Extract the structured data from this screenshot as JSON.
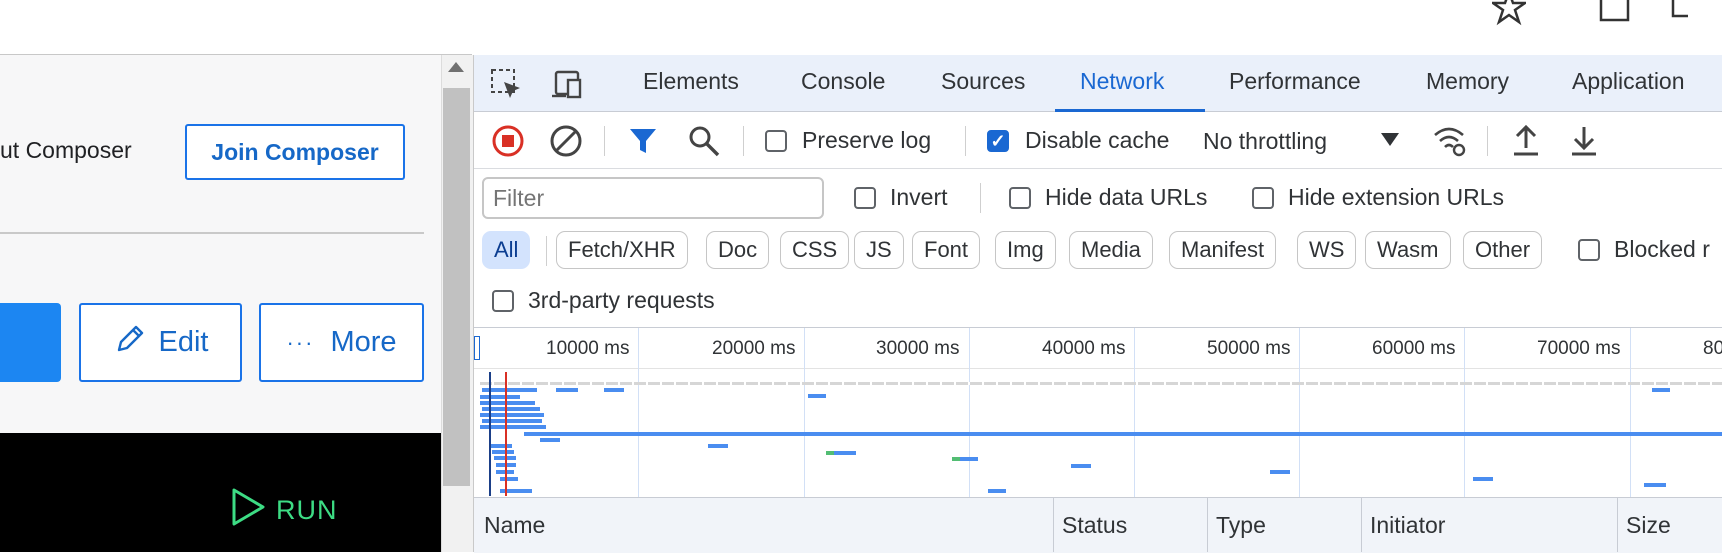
{
  "browser": {
    "icons": [
      "star-icon",
      "extensions-icon"
    ]
  },
  "page": {
    "about_text": "ut Composer",
    "join_label": "Join Composer",
    "edit_label": "Edit",
    "more_label": "More",
    "more_dots": "···",
    "run_label": "RUN"
  },
  "devtools": {
    "tabs": [
      "Elements",
      "Console",
      "Sources",
      "Network",
      "Performance",
      "Memory",
      "Application"
    ],
    "active_tab": "Network",
    "toolbar": {
      "preserve_log": "Preserve log",
      "preserve_log_checked": false,
      "disable_cache": "Disable cache",
      "disable_cache_checked": true,
      "throttling": "No throttling"
    },
    "filter": {
      "placeholder": "Filter",
      "invert": "Invert",
      "hide_data_urls": "Hide data URLs",
      "hide_extension_urls": "Hide extension URLs"
    },
    "chips": [
      "All",
      "Fetch/XHR",
      "Doc",
      "CSS",
      "JS",
      "Font",
      "Img",
      "Media",
      "Manifest",
      "WS",
      "Wasm",
      "Other"
    ],
    "active_chip": "All",
    "blocked_label": "Blocked r",
    "third_party": "3rd-party requests",
    "timeline": {
      "ticks": [
        "10000 ms",
        "20000 ms",
        "30000 ms",
        "40000 ms",
        "50000 ms",
        "60000 ms",
        "70000 ms",
        "80"
      ]
    },
    "columns": [
      "Name",
      "Status",
      "Type",
      "Initiator",
      "Size"
    ],
    "colors": {
      "accent": "#1a68d2",
      "bar": "#4a8df0",
      "dom_line": "#1b3f88",
      "load_line": "#d93025"
    }
  }
}
